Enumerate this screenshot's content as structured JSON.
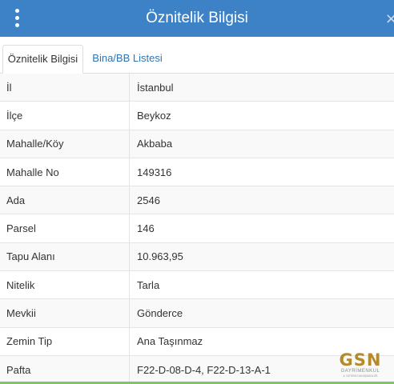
{
  "header": {
    "title": "Öznitelik Bilgisi",
    "close_glyph": "×",
    "background_color": "#3d82c7"
  },
  "tabs": [
    {
      "label": "Öznitelik Bilgisi",
      "active": true
    },
    {
      "label": "Bina/BB Listesi",
      "active": false
    }
  ],
  "attributes": [
    {
      "label": "İl",
      "value": "İstanbul"
    },
    {
      "label": "İlçe",
      "value": "Beykoz"
    },
    {
      "label": "Mahalle/Köy",
      "value": "Akbaba"
    },
    {
      "label": "Mahalle No",
      "value": "149316"
    },
    {
      "label": "Ada",
      "value": "2546"
    },
    {
      "label": "Parsel",
      "value": "146"
    },
    {
      "label": "Tapu Alanı",
      "value": "10.963,95"
    },
    {
      "label": "Nitelik",
      "value": "Tarla"
    },
    {
      "label": "Mevkii",
      "value": "Gönderce"
    },
    {
      "label": "Zemin Tip",
      "value": "Ana Taşınmaz"
    },
    {
      "label": "Pafta",
      "value": "F22-D-08-D-4, F22-D-13-A-1"
    }
  ],
  "watermark": {
    "brand": "GSN",
    "subtitle": "GAYRİMENKUL",
    "tagline": "& YATIRIM DANIŞMANLIĞI"
  }
}
